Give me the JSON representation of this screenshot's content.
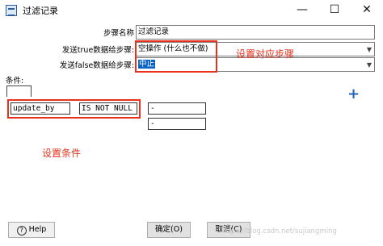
{
  "window": {
    "title": "过滤记录",
    "minimize_glyph": "—",
    "maximize_glyph": "☐",
    "close_glyph": "✕"
  },
  "form": {
    "step_name_label": "步骤名称",
    "step_name_value": "过滤记录",
    "true_step_label": "发送true数据给步骤:",
    "true_step_value": "空操作 (什么也不做)",
    "false_step_label": "发送false数据给步骤:",
    "false_step_value": "中止"
  },
  "annotations": {
    "set_step": "设置对应步骤",
    "set_condition": "设置条件"
  },
  "conditions": {
    "label": "条件:",
    "field": "update_by",
    "operator": "IS NOT NULL",
    "value1": "-",
    "value2": "-",
    "add_glyph": "+"
  },
  "buttons": {
    "help": "Help",
    "ok": "确定(O)",
    "cancel": "取消(C)"
  },
  "watermark": "https://blog.csdn.net/sujiangming",
  "colors": {
    "annotation_red": "#e8321e",
    "selection_blue": "#0a64c8",
    "plus_blue": "#2166b8"
  }
}
